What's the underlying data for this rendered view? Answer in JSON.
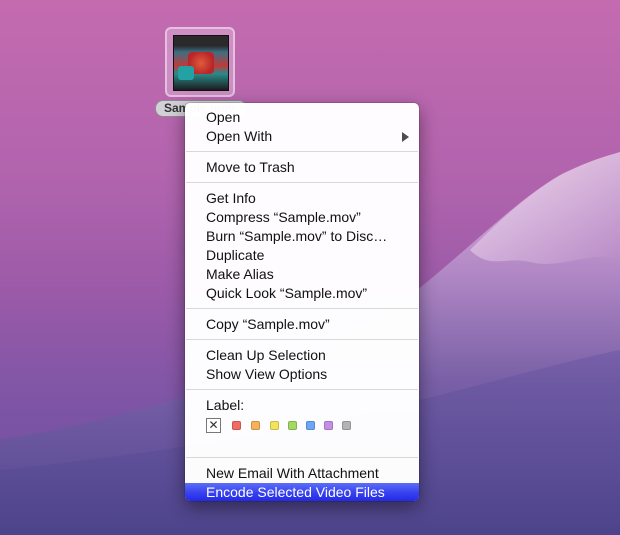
{
  "desktop": {
    "file_name": "Sample.mov"
  },
  "menu": {
    "items": [
      {
        "label": "Open"
      },
      {
        "label": "Open With"
      },
      {
        "label": "Move to Trash"
      },
      {
        "label": "Get Info"
      },
      {
        "label": "Compress “Sample.mov”"
      },
      {
        "label": "Burn “Sample.mov” to Disc…"
      },
      {
        "label": "Duplicate"
      },
      {
        "label": "Make Alias"
      },
      {
        "label": "Quick Look “Sample.mov”"
      },
      {
        "label": "Copy “Sample.mov”"
      },
      {
        "label": "Clean Up Selection"
      },
      {
        "label": "Show View Options"
      },
      {
        "label": "New Email With Attachment"
      },
      {
        "label": "Encode Selected Video Files"
      }
    ],
    "label_heading": "Label:",
    "label_none_glyph": "✕",
    "label_colors": [
      "#f06b63",
      "#f7b258",
      "#f2e55c",
      "#a3d963",
      "#6aa8f7",
      "#c58ee6",
      "#b3b3b3"
    ],
    "highlight_color": "#3843f0"
  }
}
